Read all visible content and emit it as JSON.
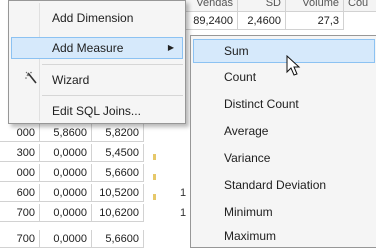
{
  "grid": {
    "header": [
      "Vendas",
      "SD",
      "Volume",
      "Cou"
    ],
    "top_row": [
      "89,2400",
      "2,4600",
      "27,3"
    ],
    "rows": [
      [
        "000",
        "5,8600",
        "5,8200"
      ],
      [
        "300",
        "0,0000",
        "5,4500"
      ],
      [
        "000",
        "0,0000",
        "5,6600"
      ],
      [
        "600",
        "0,0000",
        "10,5200"
      ],
      [
        "700",
        "0,0000",
        "10,6200"
      ],
      [
        "700",
        "0,0000",
        "5,6600"
      ]
    ],
    "peek_values": [
      "1",
      "1",
      ""
    ]
  },
  "context_menu": {
    "items": [
      {
        "label": "Add Dimension"
      },
      {
        "label": "Add Measure",
        "has_submenu": true,
        "highlighted": true
      },
      {
        "label": "Wizard",
        "icon": "magic-wand-icon"
      },
      {
        "label": "Edit SQL Joins..."
      }
    ],
    "submenu_arrow": "▶"
  },
  "submenu": {
    "items": [
      {
        "label": "Sum",
        "highlighted": true
      },
      {
        "label": "Count"
      },
      {
        "label": "Distinct Count"
      },
      {
        "label": "Average"
      },
      {
        "label": "Variance"
      },
      {
        "label": "Standard Deviation"
      },
      {
        "label": "Minimum"
      },
      {
        "label": "Maximum"
      }
    ]
  },
  "colors": {
    "menu_bg": "#f5f5f5",
    "highlight_bg": "#d6e9fb",
    "highlight_border": "#8cc2f2",
    "menu_border": "#979797"
  }
}
